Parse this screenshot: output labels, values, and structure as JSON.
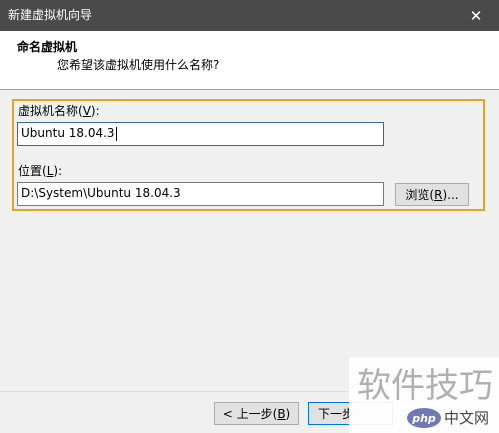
{
  "window": {
    "title": "新建虚拟机向导",
    "close_glyph": "✕"
  },
  "header": {
    "title": "命名虚拟机",
    "subtitle": "您希望该虚拟机使用什么名称?"
  },
  "form": {
    "name_label_prefix": "虚拟机名称(",
    "name_label_key": "V",
    "name_label_suffix": "):",
    "name_value": "Ubuntu 18.04.3",
    "location_label_prefix": "位置(",
    "location_label_key": "L",
    "location_label_suffix": "):",
    "location_value": "D:\\System\\Ubuntu 18.04.3",
    "browse_prefix": "浏览(",
    "browse_key": "R",
    "browse_suffix": ")..."
  },
  "footer": {
    "back_prefix": "< 上一步(",
    "back_key": "B",
    "back_suffix": ")",
    "next_label": "下一步"
  },
  "watermark": {
    "text": "软件技巧",
    "logo_php": "php",
    "logo_cn": "中文网"
  },
  "colors": {
    "titlebar": "#4a4a4a",
    "highlight_border": "#e4a423",
    "focus_border": "#2f6d8e",
    "default_button_border": "#0078d7",
    "php_logo_bg": "#7178b5"
  }
}
